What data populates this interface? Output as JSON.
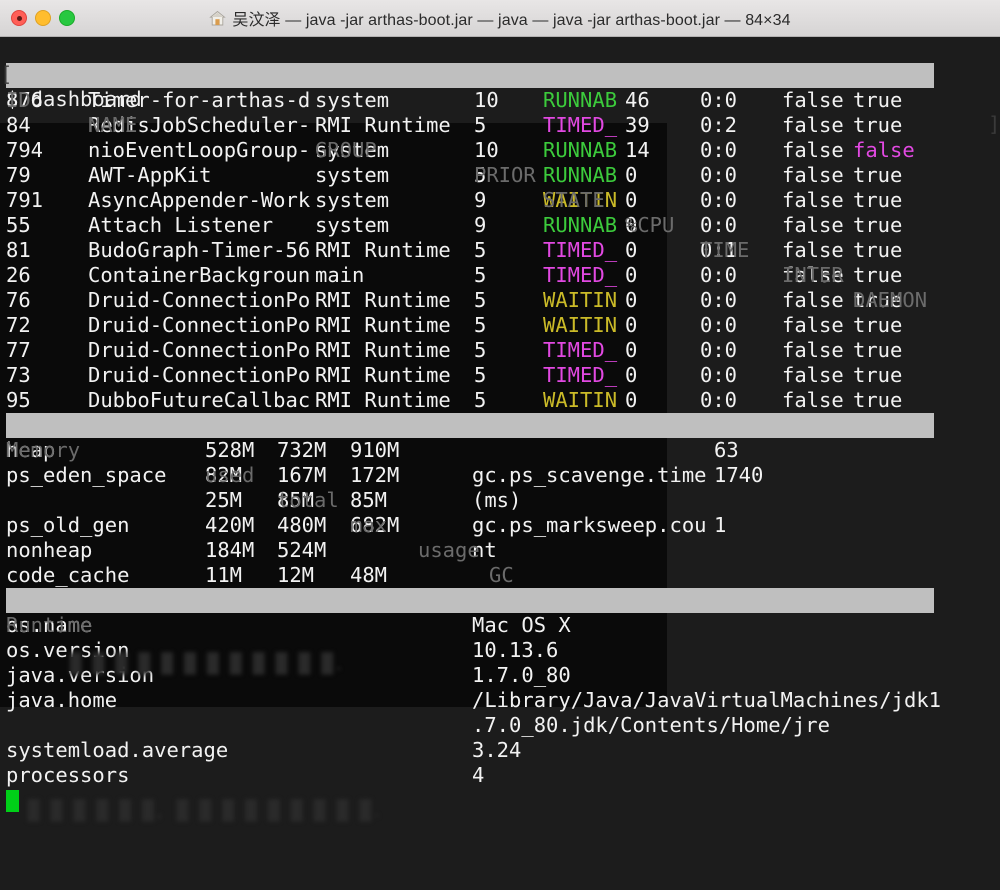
{
  "window": {
    "title": "吴汶泽 — java -jar arthas-boot.jar — java — java -jar arthas-boot.jar — 84×34",
    "home_icon": "home-icon",
    "buttons": {
      "close": "close",
      "minimize": "minimize",
      "maximize": "maximize"
    }
  },
  "terminal": {
    "prompt_line": "$ dashboard",
    "prompt_bracket_left": "[",
    "prompt_bracket_right": "]",
    "cursor": "block-cursor"
  },
  "threads": {
    "headers": {
      "id": "ID",
      "name": "NAME",
      "group": "GROUP",
      "prior": "PRIOR",
      "state": "STATE",
      "cpu": "%CPU",
      "time": "TIME",
      "inter": "INTER",
      "daemon": "DAEMON"
    },
    "rows": [
      {
        "id": "876",
        "name": "Timer-for-arthas-d",
        "group": "system",
        "prior": "10",
        "state": "RUNNAB",
        "state_color": "green",
        "cpu": "46",
        "time": "0:0",
        "inter": "false",
        "daemon": "true",
        "daemon_color": "white"
      },
      {
        "id": "84",
        "name": "RedisJobScheduler-",
        "group": "RMI Runtime",
        "prior": "5",
        "state": "TIMED_",
        "state_color": "magenta",
        "cpu": "39",
        "time": "0:2",
        "inter": "false",
        "daemon": "true",
        "daemon_color": "white"
      },
      {
        "id": "794",
        "name": "nioEventLoopGroup-",
        "group": "system",
        "prior": "10",
        "state": "RUNNAB",
        "state_color": "green",
        "cpu": "14",
        "time": "0:0",
        "inter": "false",
        "daemon": "false",
        "daemon_color": "magenta"
      },
      {
        "id": "79",
        "name": "AWT-AppKit",
        "group": "system",
        "prior": "5",
        "state": "RUNNAB",
        "state_color": "green",
        "cpu": "0",
        "time": "0:0",
        "inter": "false",
        "daemon": "true",
        "daemon_color": "white"
      },
      {
        "id": "791",
        "name": "AsyncAppender-Work",
        "group": "system",
        "prior": "9",
        "state": "WAITIN",
        "state_color": "yellow",
        "cpu": "0",
        "time": "0:0",
        "inter": "false",
        "daemon": "true",
        "daemon_color": "white"
      },
      {
        "id": "55",
        "name": "Attach Listener",
        "group": "system",
        "prior": "9",
        "state": "RUNNAB",
        "state_color": "green",
        "cpu": "0",
        "time": "0:0",
        "inter": "false",
        "daemon": "true",
        "daemon_color": "white"
      },
      {
        "id": "81",
        "name": "BudoGraph-Timer-56",
        "group": "RMI Runtime",
        "prior": "5",
        "state": "TIMED_",
        "state_color": "magenta",
        "cpu": "0",
        "time": "0:1",
        "inter": "false",
        "daemon": "true",
        "daemon_color": "white"
      },
      {
        "id": "26",
        "name": "ContainerBackgroun",
        "group": "main",
        "prior": "5",
        "state": "TIMED_",
        "state_color": "magenta",
        "cpu": "0",
        "time": "0:0",
        "inter": "false",
        "daemon": "true",
        "daemon_color": "white"
      },
      {
        "id": "76",
        "name": "Druid-ConnectionPo",
        "group": "RMI Runtime",
        "prior": "5",
        "state": "WAITIN",
        "state_color": "yellow",
        "cpu": "0",
        "time": "0:0",
        "inter": "false",
        "daemon": "true",
        "daemon_color": "white"
      },
      {
        "id": "72",
        "name": "Druid-ConnectionPo",
        "group": "RMI Runtime",
        "prior": "5",
        "state": "WAITIN",
        "state_color": "yellow",
        "cpu": "0",
        "time": "0:0",
        "inter": "false",
        "daemon": "true",
        "daemon_color": "white"
      },
      {
        "id": "77",
        "name": "Druid-ConnectionPo",
        "group": "RMI Runtime",
        "prior": "5",
        "state": "TIMED_",
        "state_color": "magenta",
        "cpu": "0",
        "time": "0:0",
        "inter": "false",
        "daemon": "true",
        "daemon_color": "white"
      },
      {
        "id": "73",
        "name": "Druid-ConnectionPo",
        "group": "RMI Runtime",
        "prior": "5",
        "state": "TIMED_",
        "state_color": "magenta",
        "cpu": "0",
        "time": "0:0",
        "inter": "false",
        "daemon": "true",
        "daemon_color": "white"
      },
      {
        "id": "95",
        "name": "DubboFutureCallbac",
        "group": "RMI Runtime",
        "prior": "5",
        "state": "WAITIN",
        "state_color": "yellow",
        "cpu": "0",
        "time": "0:0",
        "inter": "false",
        "daemon": "true",
        "daemon_color": "white"
      }
    ]
  },
  "memory": {
    "headers": {
      "name": "Memory",
      "used": "used",
      "total": "total",
      "max": "max",
      "usage": "usage",
      "gc": "GC"
    },
    "rows": [
      {
        "name": "heap",
        "used": "528M",
        "total": "732M",
        "max": "910M",
        "usage": "",
        "gc_label": "",
        "gc_value": "63"
      },
      {
        "name": "ps_eden_space",
        "used": "82M",
        "total": "167M",
        "max": "172M",
        "usage": "",
        "gc_label": "gc.ps_scavenge.time",
        "gc_value": "1740"
      },
      {
        "name": "",
        "used": "25M",
        "total": "85M",
        "max": "85M",
        "usage": "",
        "gc_label": "(ms)",
        "gc_value": ""
      },
      {
        "name": "ps_old_gen",
        "used": "420M",
        "total": "480M",
        "max": "682M",
        "usage": "",
        "gc_label": "gc.ps_marksweep.cou",
        "gc_value": "1"
      },
      {
        "name": "nonheap",
        "used": "184M",
        "total": "524M",
        "max": "",
        "usage": "",
        "gc_label": "nt",
        "gc_value": ""
      },
      {
        "name": "code_cache",
        "used": "11M",
        "total": "12M",
        "max": "48M",
        "usage": "",
        "gc_label": "",
        "gc_value": ""
      }
    ]
  },
  "runtime": {
    "header": "Runtime",
    "rows": [
      {
        "key": "os.name",
        "value": "Mac OS X"
      },
      {
        "key": "os.version",
        "value": "10.13.6"
      },
      {
        "key": "java.version",
        "value": "1.7.0_80"
      },
      {
        "key": "java.home",
        "value": "/Library/Java/JavaVirtualMachines/jdk1"
      },
      {
        "key": "",
        "value": ".7.0_80.jdk/Contents/Home/jre"
      },
      {
        "key": "systemload.average",
        "value": "3.24"
      },
      {
        "key": "processors",
        "value": "4"
      }
    ]
  },
  "colors": {
    "background": "#1c1c1c",
    "foreground": "#e8e8e8",
    "header_bar": "#bfbfbf",
    "header_text": "#6b6b6b",
    "green": "#3ccb3c",
    "magenta": "#e249e2",
    "yellow": "#cbbb28",
    "cursor": "#00cf18",
    "titlebar": "#e0dede"
  }
}
